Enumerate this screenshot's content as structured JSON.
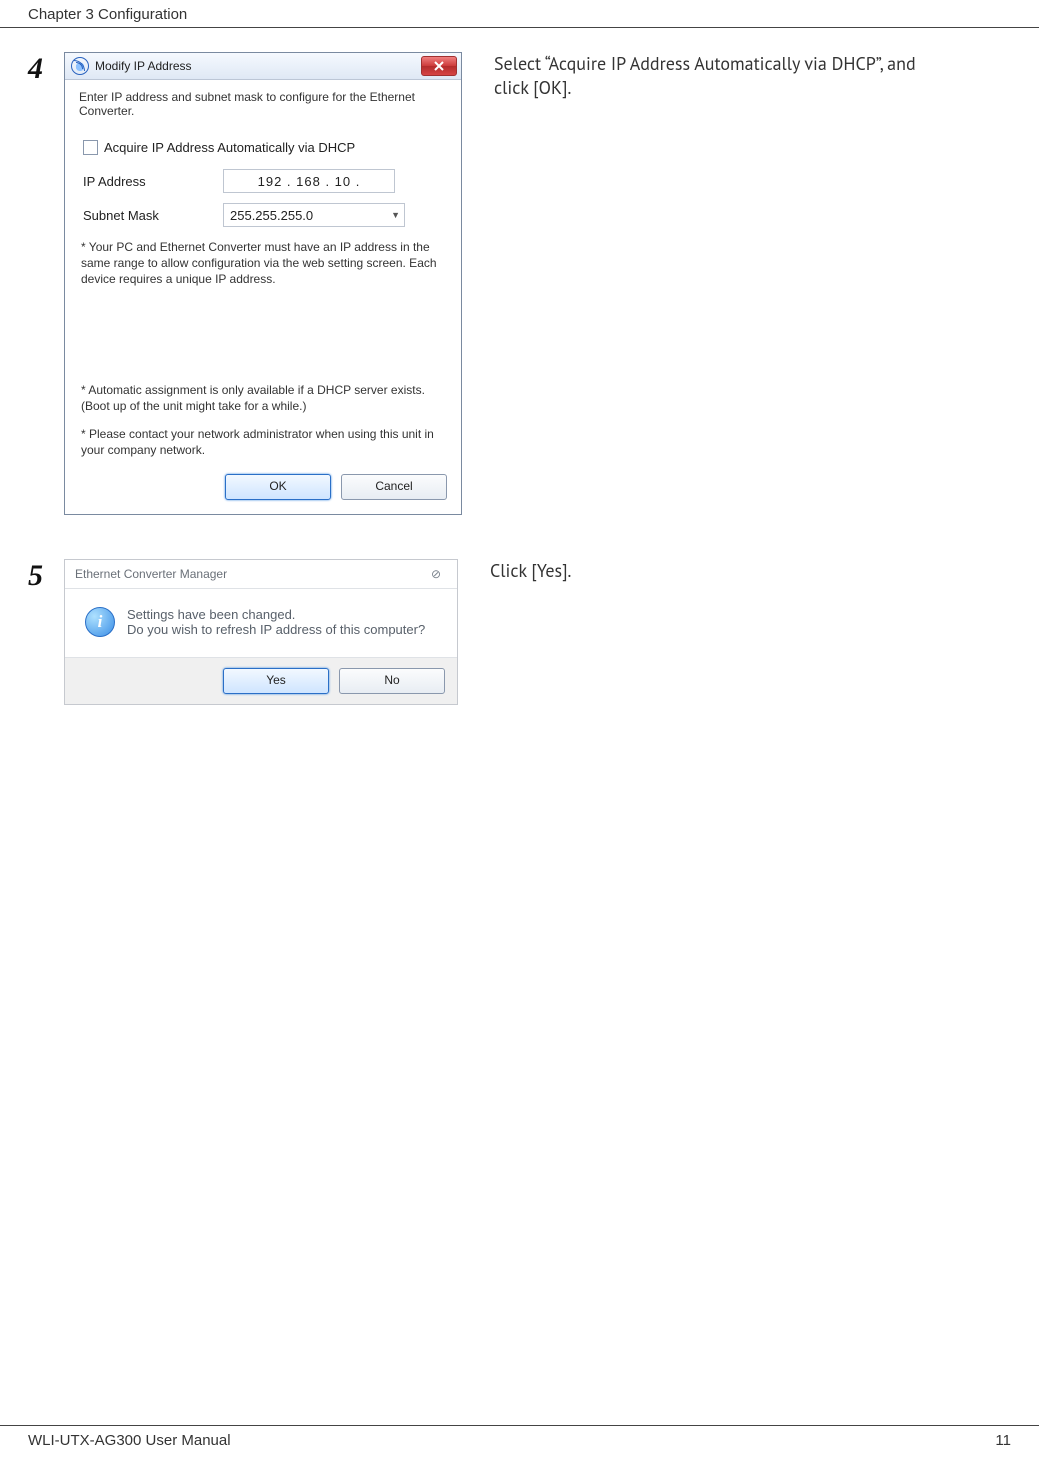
{
  "header": {
    "chapter": "Chapter 3  Configuration"
  },
  "footer": {
    "left": "WLI-UTX-AG300 User Manual",
    "right": "11"
  },
  "step4": {
    "number": "4",
    "instruction": "Select “Acquire IP Address Automatically via DHCP”, and click [OK].",
    "dialog": {
      "title": "Modify IP Address",
      "intro": "Enter IP address and subnet mask to configure for the Ethernet Converter.",
      "checkbox_label": "Acquire IP Address Automatically via DHCP",
      "ip_label": "IP Address",
      "ip_value": "192  .   168   .    10    .",
      "subnet_label": "Subnet Mask",
      "subnet_value": "255.255.255.0",
      "note1": "* Your PC and Ethernet Converter must have an IP address in the same range to allow configuration via the web setting screen. Each device requires a unique IP address.",
      "note2": "* Automatic assignment is only available if a DHCP server exists.\n  (Boot up of the unit might take for a while.)",
      "note3": "* Please contact your network administrator when using this unit in your company network.",
      "ok": "OK",
      "cancel": "Cancel"
    }
  },
  "step5": {
    "number": "5",
    "instruction": "Click [Yes].",
    "dialog": {
      "title": "Ethernet Converter Manager",
      "line1": "Settings have been changed.",
      "line2": "Do you wish to refresh IP address of this computer?",
      "yes": "Yes",
      "no": "No",
      "close_glyph": "⊘"
    }
  }
}
